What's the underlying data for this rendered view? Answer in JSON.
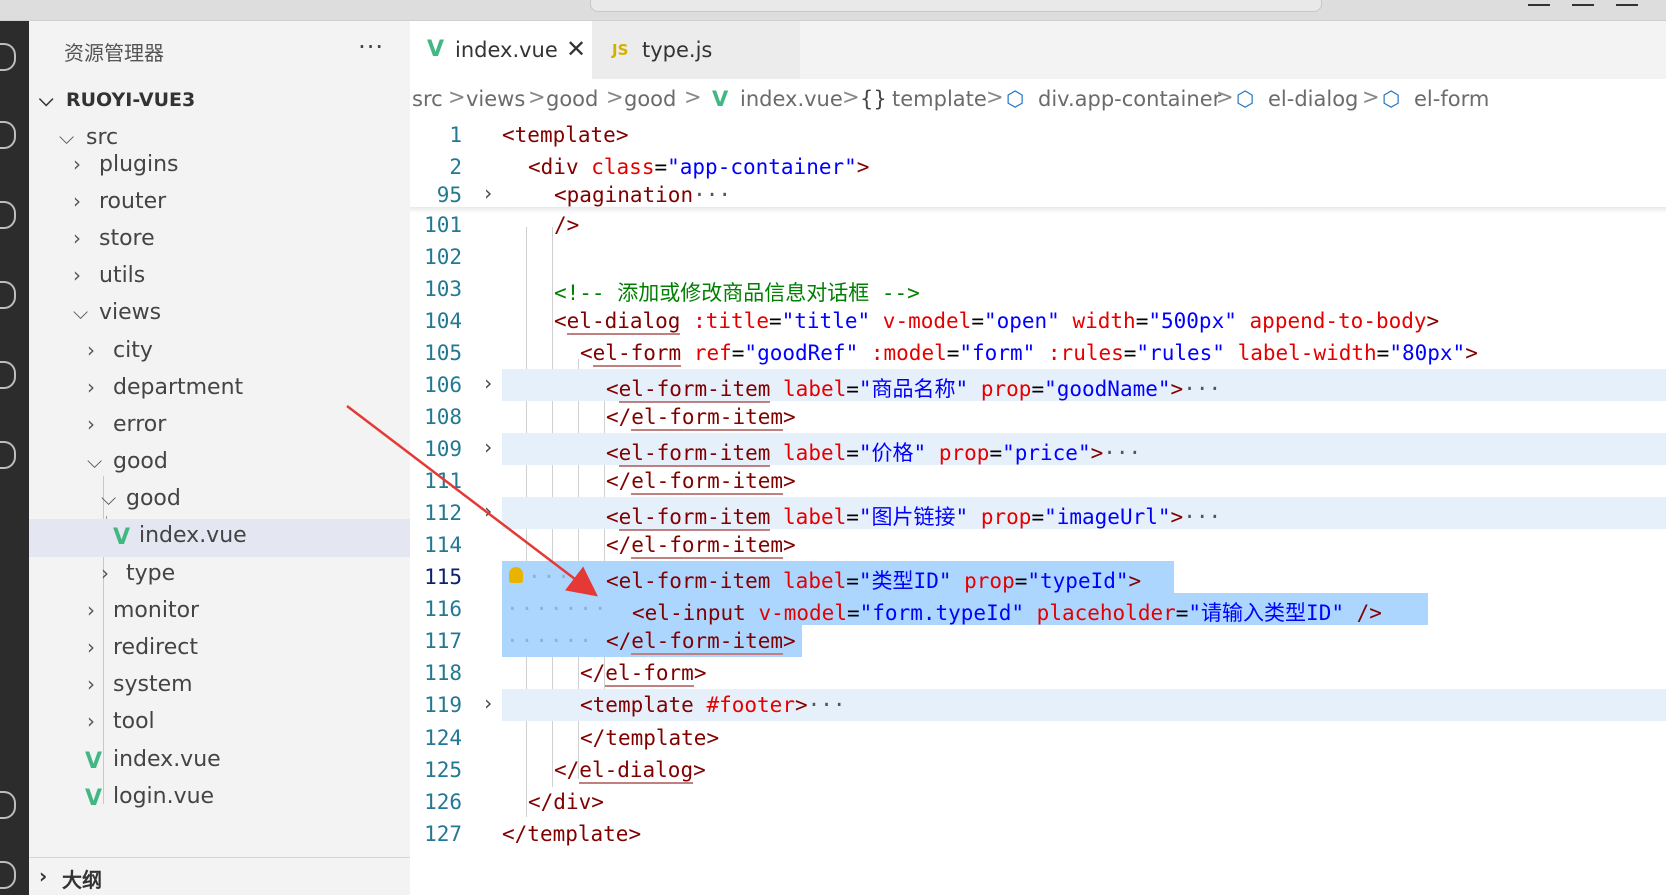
{
  "explorer": {
    "title": "资源管理器",
    "more": "···",
    "project": "RUOYI-VUE3",
    "tree": [
      {
        "label": "src",
        "type": "folder",
        "open": true
      },
      {
        "label": "plugins",
        "type": "folder"
      },
      {
        "label": "router",
        "type": "folder"
      },
      {
        "label": "store",
        "type": "folder"
      },
      {
        "label": "utils",
        "type": "folder"
      },
      {
        "label": "views",
        "type": "folder",
        "open": true
      },
      {
        "label": "city",
        "type": "folder"
      },
      {
        "label": "department",
        "type": "folder"
      },
      {
        "label": "error",
        "type": "folder"
      },
      {
        "label": "good",
        "type": "folder",
        "open": true
      },
      {
        "label": "good",
        "type": "folder",
        "open": true
      },
      {
        "label": "index.vue",
        "type": "vue",
        "selected": true
      },
      {
        "label": "type",
        "type": "folder"
      },
      {
        "label": "monitor",
        "type": "folder"
      },
      {
        "label": "redirect",
        "type": "folder"
      },
      {
        "label": "system",
        "type": "folder"
      },
      {
        "label": "tool",
        "type": "folder"
      },
      {
        "label": "index.vue",
        "type": "vue"
      },
      {
        "label": "login.vue",
        "type": "vue"
      }
    ],
    "outline": "大纲"
  },
  "tabs": [
    {
      "label": "index.vue",
      "icon": "vue-icon",
      "active": true,
      "close": "✕"
    },
    {
      "label": "type.js",
      "icon": "js-icon",
      "icon_text": "JS",
      "active": false
    }
  ],
  "breadcrumb": {
    "items": [
      "src",
      "views",
      "good",
      "good",
      "index.vue",
      "template",
      "div.app-container",
      "el-dialog",
      "el-form"
    ],
    "template_icon": "{}",
    "sep": ">"
  },
  "editor": {
    "lines": [
      {
        "no": "1",
        "text": "<template>"
      },
      {
        "no": "2",
        "text": "<div class=\"app-container\">"
      },
      {
        "no": "95",
        "text": "<pagination···"
      },
      {
        "no": "101",
        "text": "/>"
      },
      {
        "no": "102",
        "text": ""
      },
      {
        "no": "103",
        "text": "<!-- 添加或修改商品信息对话框 -->"
      },
      {
        "no": "104",
        "text": "<el-dialog :title=\"title\" v-model=\"open\" width=\"500px\" append-to-body>"
      },
      {
        "no": "105",
        "text": "<el-form ref=\"goodRef\" :model=\"form\" :rules=\"rules\" label-width=\"80px\">"
      },
      {
        "no": "106",
        "text": "<el-form-item label=\"商品名称\" prop=\"goodName\">···"
      },
      {
        "no": "108",
        "text": "</el-form-item>"
      },
      {
        "no": "109",
        "text": "<el-form-item label=\"价格\" prop=\"price\">···"
      },
      {
        "no": "111",
        "text": "</el-form-item>"
      },
      {
        "no": "112",
        "text": "<el-form-item label=\"图片链接\" prop=\"imageUrl\">···"
      },
      {
        "no": "114",
        "text": "</el-form-item>"
      },
      {
        "no": "115",
        "text": "<el-form-item label=\"类型ID\" prop=\"typeId\">"
      },
      {
        "no": "116",
        "text": "<el-input v-model=\"form.typeId\" placeholder=\"请输入类型ID\" />"
      },
      {
        "no": "117",
        "text": "</el-form-item>"
      },
      {
        "no": "118",
        "text": "</el-form>"
      },
      {
        "no": "119",
        "text": "<template #footer>···"
      },
      {
        "no": "124",
        "text": "</template>"
      },
      {
        "no": "125",
        "text": "</el-dialog>"
      },
      {
        "no": "126",
        "text": "</div>"
      },
      {
        "no": "127",
        "text": "</template>"
      }
    ]
  },
  "colors": {
    "tag": "#800000",
    "attr": "#e50000",
    "string": "#0000ff",
    "comment": "#008000",
    "line_number": "#237893",
    "selection": "#add6ff",
    "vue": "#41b883",
    "annotation_arrow": "#e53935"
  }
}
